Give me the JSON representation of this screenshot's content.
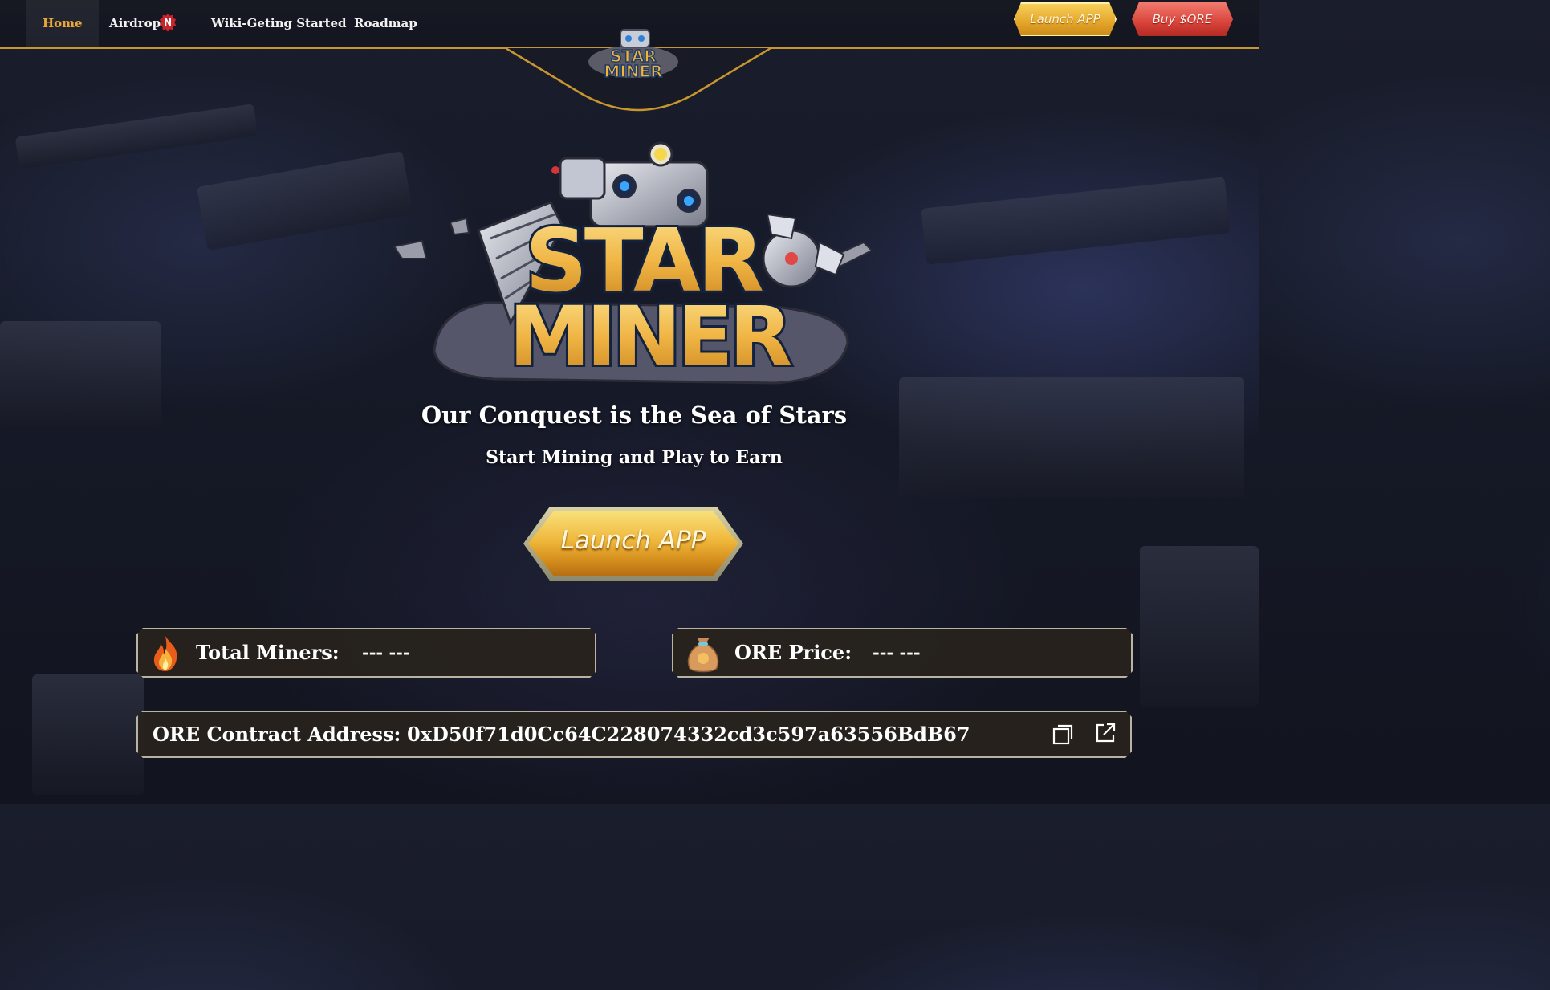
{
  "nav": {
    "items": [
      {
        "label": "Home",
        "active": true
      },
      {
        "label": "Airdrop",
        "badge": "N"
      },
      {
        "label": "Wiki-Geting Started"
      },
      {
        "label": "Roadmap"
      }
    ],
    "launch_label": "Launch APP",
    "buy_label": "Buy $ORE",
    "accent_color": "#c8962e"
  },
  "brand": {
    "logo_text_line1": "STAR",
    "logo_text_line2": "MINER"
  },
  "hero": {
    "headline": "Our Conquest is the Sea of Stars",
    "subheadline": "Start Mining and Play to Earn",
    "launch_label": "Launch APP"
  },
  "stats": {
    "total_miners": {
      "label": "Total Miners:",
      "value": "--- ---",
      "icon": "fire-icon"
    },
    "ore_price": {
      "label": "ORE Price:",
      "value": "--- ---",
      "icon": "money-bag-icon"
    }
  },
  "contract": {
    "label": "ORE Contract Address:",
    "address": "0xD50f71d0Cc64C228074332cd3c597a63556BdB67",
    "copy_icon": "copy-icon",
    "open_icon": "external-link-icon"
  }
}
